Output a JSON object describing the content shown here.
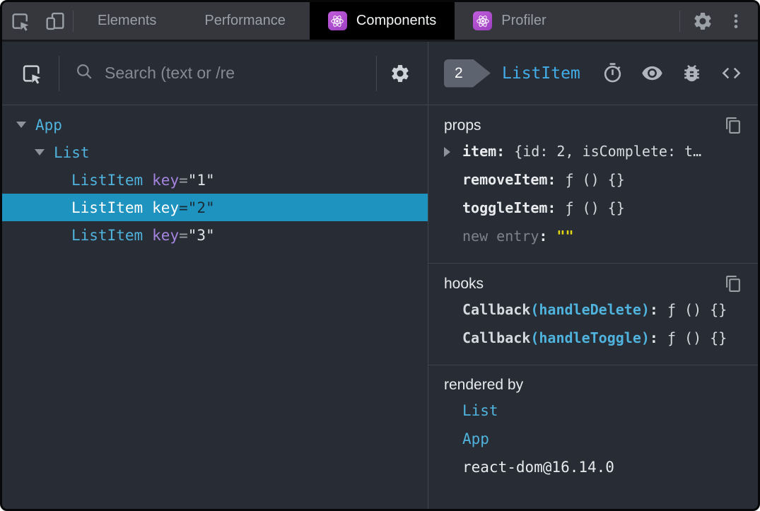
{
  "top_bar": {
    "tabs": [
      {
        "label": "Elements"
      },
      {
        "label": "Performance"
      },
      {
        "label": "Components",
        "active": true,
        "icon": "react-logo"
      },
      {
        "label": "Profiler",
        "icon": "react-logo"
      }
    ]
  },
  "left_panel": {
    "search": {
      "placeholder": "Search (text or /re"
    },
    "tree": [
      {
        "name": "App",
        "expanded": true,
        "depth": 0
      },
      {
        "name": "List",
        "expanded": true,
        "depth": 1
      },
      {
        "name": "ListItem",
        "attr": "key",
        "eq": "=",
        "value": "\"1\"",
        "depth": 2
      },
      {
        "name": "ListItem",
        "attr": "key",
        "eq": "=",
        "value": "\"2\"",
        "depth": 2,
        "selected": true
      },
      {
        "name": "ListItem",
        "attr": "key",
        "eq": "=",
        "value": "\"3\"",
        "depth": 2
      }
    ]
  },
  "right_panel": {
    "header": {
      "badge": "2",
      "title": "ListItem"
    },
    "props": {
      "title": "props",
      "rows": [
        {
          "name": "item",
          "sep": ":",
          "value": "{id: 2, isComplete: t…",
          "expandable": true
        },
        {
          "name": "removeItem",
          "sep": ":",
          "value": "ƒ () {}"
        },
        {
          "name": "toggleItem",
          "sep": ":",
          "value": "ƒ () {}"
        },
        {
          "name": "new entry",
          "sep": ":",
          "value": "\"\"",
          "editable_placeholder": true
        }
      ]
    },
    "hooks": {
      "title": "hooks",
      "rows": [
        {
          "prefix": "Callback",
          "fn": "(handleDelete)",
          "sep": ":",
          "value": "ƒ () {}"
        },
        {
          "prefix": "Callback",
          "fn": "(handleToggle)",
          "sep": ":",
          "value": "ƒ () {}"
        }
      ]
    },
    "rendered_by": {
      "title": "rendered by",
      "items": [
        {
          "label": "List"
        },
        {
          "label": "App"
        },
        {
          "label": "react-dom@16.14.0"
        }
      ]
    }
  },
  "colors": {
    "topbar_bg": "#35373c",
    "panel_bg": "#282c34",
    "active_tab_bg": "#000000",
    "accent_cyan": "#4fb3dd",
    "title_cyan": "#43ade8",
    "selected_row_blue": "#1e93c0",
    "key_purple": "#a584e0",
    "string_yellow": "#e3d713",
    "react_purple": "#b452ce",
    "divider": "#41454d"
  }
}
